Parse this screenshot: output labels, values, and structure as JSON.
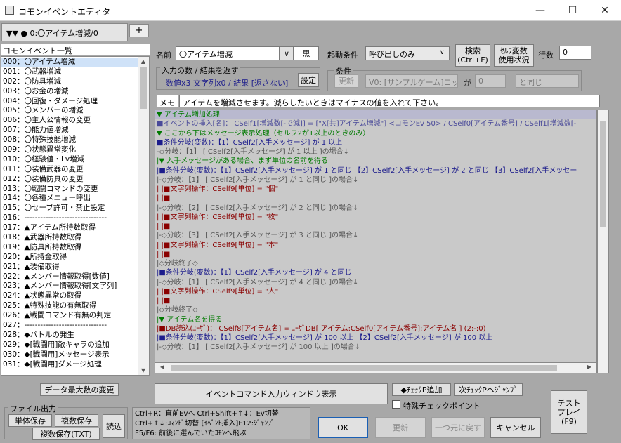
{
  "window": {
    "title": "コモンイベントエディタ",
    "minimize": "—",
    "maximize": "☐",
    "close": "✕"
  },
  "tab": {
    "label": "▼▼ ● 0:〇アイテム増減/0",
    "plus": "+"
  },
  "list": {
    "header": "コモンイベント一覧",
    "items": [
      "000：〇アイテム増減",
      "001：〇武器増減",
      "002：〇防具増減",
      "003：〇お金の増減",
      "004：〇回復・ダメージ処理",
      "005：〇メンバーの増減",
      "006：〇主人公情報の変更",
      "007：〇能力値増減",
      "008：〇特殊技能増減",
      "009：〇状態異常変化",
      "010：〇経験値・Lv増減",
      "011：〇装備武器の変更",
      "012：〇装備防具の変更",
      "013：〇戦闘コマンドの変更",
      "014：〇各種メニュー呼出",
      "015：〇セーブ許可・禁止設定",
      "016：-------------------------------",
      "017：▲アイテム所持数取得",
      "018：▲武器所持数取得",
      "019：▲防具所持数取得",
      "020：▲所持金取得",
      "021：▲装備取得",
      "022：▲メンバー情報取得[数値]",
      "023：▲メンバー情報取得[文字列]",
      "024：▲状態異常の取得",
      "025：▲特殊技能の有無取得",
      "026：▲戦闘コマンド有無の判定",
      "027：-------------------------------",
      "028：◆バトルの発生",
      "029：◆[戦闘用]敵キャラの追加",
      "030：◆[戦闘用]メッセージ表示",
      "031：◆[戦闘用]ダメージ処理"
    ],
    "max_button": "データ最大数の変更"
  },
  "header": {
    "name_label": "名前",
    "name_value": "〇アイテム増減",
    "name_dropdown": "∨",
    "color_label": "黒",
    "trigger_label": "起動条件",
    "trigger_value": "呼び出しのみ",
    "search_button": "検索\n(Ctrl+F)",
    "self_var_button": "ｾﾙﾌ変数\n使用状況",
    "lines_label": "行数",
    "lines_value": "0"
  },
  "io": {
    "title": "入力の数 / 結果を返す",
    "summary": "数値x3 文字列x0 / 結果 [返さない]",
    "set_button": "設定"
  },
  "condition": {
    "title": "条件",
    "update_button": "更新",
    "var_value": "V0: [サンプルゲーム]コッ",
    "ga": "が",
    "num_value": "0",
    "op_value": "と同じ"
  },
  "memo": {
    "label": "メモ",
    "text": "アイテムを増減させます。減らしたいときはマイナスの値を入れて下さい。"
  },
  "code_lines": [
    {
      "t": "▼ アイテム増加処理",
      "c": "g",
      "hl": true
    },
    {
      "t": "■イベントの挿入[名]： CSelf1[増減数[-で減]] = [\"X[共]アイテム増減\"] <コモンEv 50>  / CSelf0[アイテム番号] / CSelf1[増減数[-",
      "c": "m"
    },
    {
      "t": "▼ ここから下はメッセージ表示処理（セルフ2が1以上のときのみ）",
      "c": "g"
    },
    {
      "t": "■条件分岐(変数)：【1】CSelf2[入手メッセージ]  が   1 以上",
      "c": "b"
    },
    {
      "t": "-◇分岐：【1】 [ CSelf2[入手メッセージ]  が  1 以上 ]の場合↓",
      "c": "k"
    },
    {
      "t": "|▼ 入手メッセージがある場合、まず単位の名前を得る",
      "c": "g"
    },
    {
      "t": "|■条件分岐(変数)：【1】CSelf2[入手メッセージ]  が   1 と同じ 【2】CSelf2[入手メッセージ]  が   2 と同じ 【3】CSelf2[入手メッセー",
      "c": "b"
    },
    {
      "t": "|-◇分岐：【1】 [ CSelf2[入手メッセージ]  が  1 と同じ  ]の場合↓",
      "c": "k"
    },
    {
      "t": "| |■文字列操作：CSelf9[単位] = \"個\"",
      "c": "r"
    },
    {
      "t": "| |■",
      "c": "r"
    },
    {
      "t": "|-◇分岐：【2】 [ CSelf2[入手メッセージ]  が  2 と同じ  ]の場合↓",
      "c": "k"
    },
    {
      "t": "| |■文字列操作：CSelf9[単位] = \"枚\"",
      "c": "r"
    },
    {
      "t": "| |■",
      "c": "r"
    },
    {
      "t": "|-◇分岐：【3】 [ CSelf2[入手メッセージ]  が  3 と同じ  ]の場合↓",
      "c": "k"
    },
    {
      "t": "| |■文字列操作：CSelf9[単位] = \"本\"",
      "c": "r"
    },
    {
      "t": "| |■",
      "c": "r"
    },
    {
      "t": "|◇分岐終了◇",
      "c": "k"
    },
    {
      "t": "|■条件分岐(変数)：【1】CSelf2[入手メッセージ]  が   4 と同じ",
      "c": "b"
    },
    {
      "t": "|-◇分岐：【1】 [ CSelf2[入手メッセージ]  が  4 と同じ  ]の場合↓",
      "c": "k"
    },
    {
      "t": "| |■文字列操作：CSelf9[単位] = \"人\"",
      "c": "r"
    },
    {
      "t": "| |■",
      "c": "r"
    },
    {
      "t": "|◇分岐終了◇",
      "c": "k"
    },
    {
      "t": "|▼ アイテム名を得る",
      "c": "g"
    },
    {
      "t": "|■DB読込(ﾕｰｻﾞ)： CSelf8[アイテム名] = ﾕｰｻﾞDB[ アイテム:CSelf0[アイテム番号]:アイテム名 ] (2:-:0)",
      "c": "r"
    },
    {
      "t": "|■条件分岐(変数)：【1】CSelf2[入手メッセージ]  が  100 以上 【2】CSelf2[入手メッセージ]  が  100 以上",
      "c": "b"
    },
    {
      "t": "|-◇分岐：【1】 [ CSelf2[入手メッセージ]  が  100 以上 ]の場合↓",
      "c": "k"
    }
  ],
  "bottom": {
    "command_window_button": "イベントコマンド入力ウィンドウ表示",
    "check_add_button": "◆ﾁｪｯｸP追加",
    "next_check_button": "次ﾁｪｯｸPへｼﾞｬﾝﾌﾟ",
    "special_check_label": "特殊チェックポイント",
    "file_group": "ファイル出力",
    "single_save": "単体保存",
    "multi_save": "複数保存",
    "multi_save_txt": "複数保存(TXT)",
    "load_button": "読込",
    "help_line1": "Ctrl+R：直前Evへ  Ctrl+Shift+↑↓：Ev切替",
    "help_line2": "Ctrl+↑↓:ｺﾏﾝﾄﾞ切替 [ｲﾍﾞﾝﾄ挿入]F12:ｼﾞｬﾝﾌﾟ",
    "help_line3": "F5/F6: 前後に選んでいたｺﾓﾝへ飛ぶ",
    "ok": "OK",
    "apply": "更新",
    "undo": "一つ元に戻す",
    "cancel": "キャンセル",
    "test_play": "テスト\nプレイ\n(F9)"
  }
}
